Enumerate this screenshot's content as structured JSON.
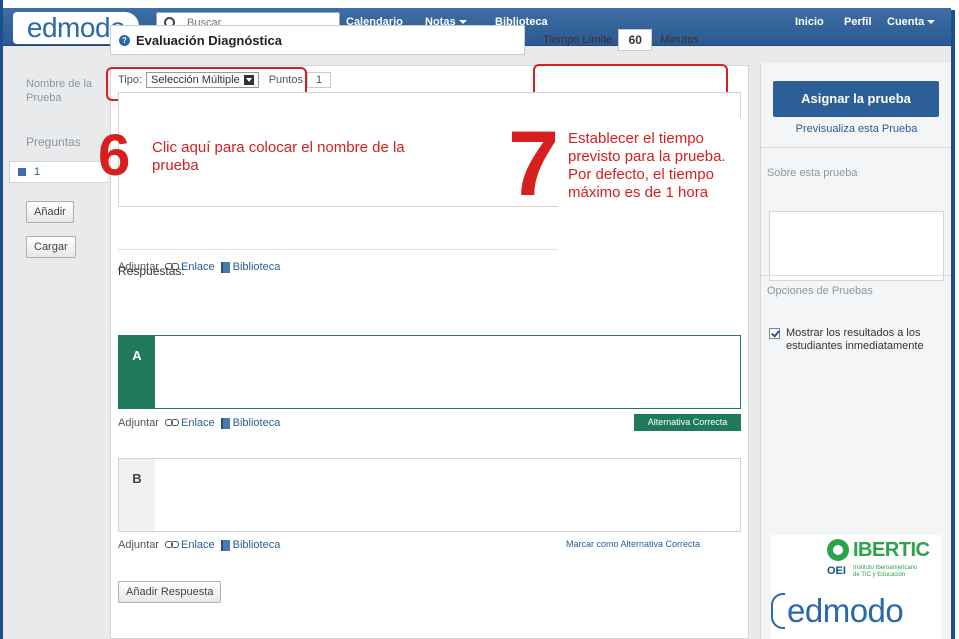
{
  "topbar": {
    "logo": "edmodo",
    "search_placeholder": "Buscar",
    "nav": {
      "calendario": "Calendario",
      "notas": "Notas",
      "biblioteca": "Biblioteca",
      "inicio": "Inicio",
      "perfil": "Perfil",
      "cuenta": "Cuenta"
    }
  },
  "left": {
    "nombre_label": "Nombre de la Prueba",
    "preguntas_label": "Preguntas",
    "question_tab": "1",
    "add_button": "Añadir",
    "load_button": "Cargar"
  },
  "form": {
    "title_value": "Evaluación Diagnóstica",
    "time_label": "Tiempo Límite",
    "time_value": "60",
    "time_unit": "Minutos",
    "tipo_label": "Tipo:",
    "tipo_value": "Selección Múltiple",
    "puntos_label": "Puntos",
    "puntos_value": "1",
    "attach_label": "Adjuntar",
    "link_label": "Enlace",
    "library_label": "Biblioteca",
    "responses_label": "Respuestas:",
    "answer_a": "A",
    "answer_b": "B",
    "correct_badge": "Alternativa Correcta",
    "mark_correct": "Marcar como Alternativa Correcta",
    "add_answer": "Añadir Respuesta"
  },
  "callouts": {
    "step6_number": "6",
    "step6_text": "Clic aquí para colocar el nombre de la prueba",
    "step7_number": "7",
    "step7_text": "Establecer el tiempo previsto para la prueba. Por defecto, el tiempo máximo es de 1 hora"
  },
  "right": {
    "assign_button": "Asignar la prueba",
    "preview_link": "Previsualiza esta Prueba",
    "about_label": "Sobre esta prueba",
    "options_label": "Opciones de Pruebas",
    "show_results": "Mostrar los resultados a los estudiantes inmediatamente",
    "ibertic": "IBERTIC",
    "oei": "OEI",
    "ibertic_sub": "Instituto Iberoamericano de TIC y Educación",
    "edmodo_logo": "edmodo"
  },
  "colors": {
    "nav_blue": "#2c5990",
    "accent_red": "#d62020",
    "correct_green": "#1f7a5a"
  }
}
